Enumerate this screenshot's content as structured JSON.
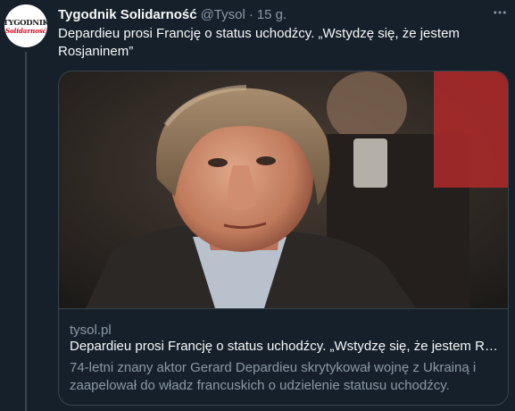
{
  "author": {
    "name": "Tygodnik Solidarność",
    "handle": "@Tysol",
    "separator": "·",
    "time": "15 g.",
    "avatar_logo": {
      "top_text": "TYGODNIK",
      "bottom_text": "Solidarność"
    }
  },
  "tweet": {
    "text": "Depardieu prosi Francję o status uchodźcy. „Wstydzę się, że jestem Rosjaninem”"
  },
  "card": {
    "domain": "tysol.pl",
    "title": "Depardieu prosi Francję o status uchodźcy. „Wstydzę się, że jestem Rosjaninem”",
    "description": "74-letni znany aktor Gerard Depardieu skrytykował wojnę z Ukrainą i zaapelował do władz francuskich o udzielenie statusu uchodźcy."
  },
  "icons": {
    "more": "more-horizontal-icon"
  },
  "colors": {
    "background": "#15202b",
    "text_primary": "#f7f9f9",
    "text_secondary": "#8b98a5",
    "border": "#38444d"
  }
}
